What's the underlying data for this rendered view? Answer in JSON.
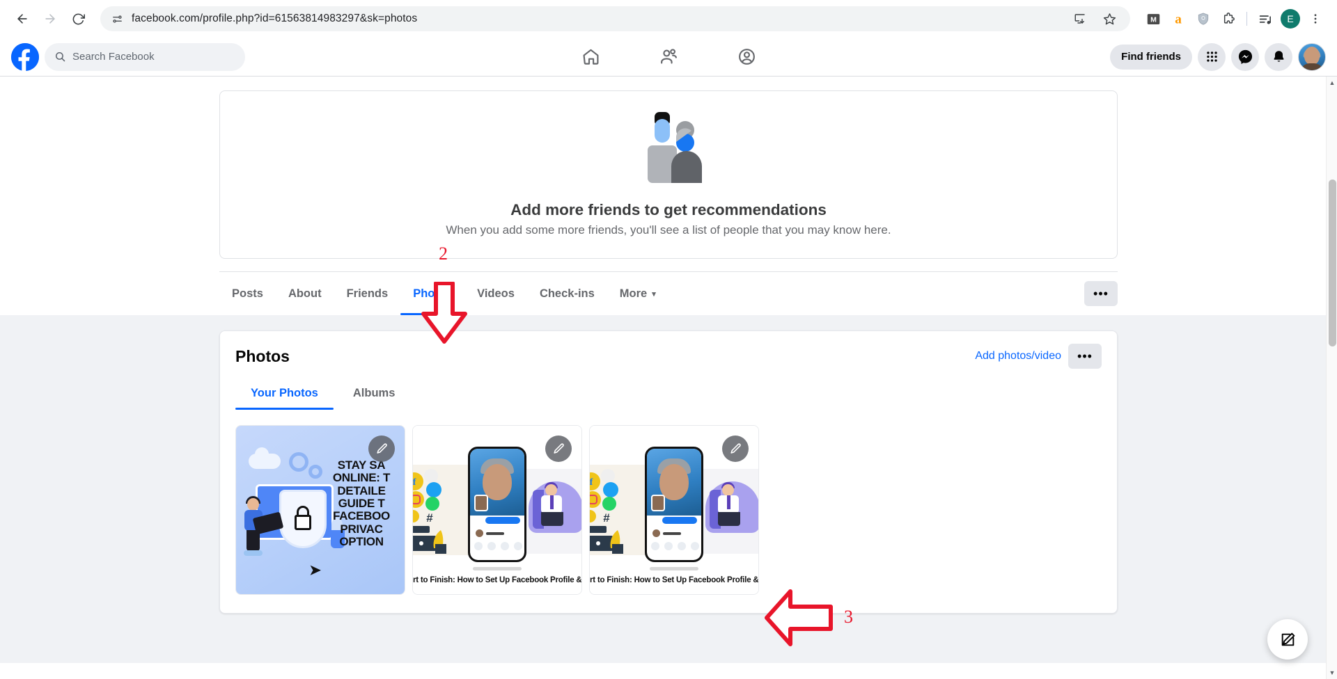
{
  "browser": {
    "back_label": "Back",
    "forward_label": "Forward",
    "reload_label": "Reload",
    "site_info_label": "View site information",
    "url": "facebook.com/profile.php?id=61563814983297&sk=photos",
    "install_label": "Install app",
    "bookmark_label": "Bookmark this tab",
    "extensions": [
      {
        "name": "mailtrack-extension-icon",
        "glyph": "M",
        "color": "#4a4a4a"
      },
      {
        "name": "amazon-extension-icon",
        "glyph": "a",
        "color": "#ff9900"
      },
      {
        "name": "shield-privacy-extension-icon",
        "glyph": "shield",
        "color": "#9aa5b1"
      },
      {
        "name": "extensions-puzzle-icon",
        "glyph": "puzzle",
        "color": "#3c4043"
      },
      {
        "name": "media-playlist-icon",
        "glyph": "playlist",
        "color": "#3c4043"
      }
    ],
    "profile_initial": "E",
    "profile_color": "#0f7b6c",
    "menu_label": "Customize and control Chrome"
  },
  "fb_header": {
    "logo_label": "Facebook",
    "search_placeholder": "Search Facebook",
    "nav": [
      {
        "name": "nav-home",
        "label": "Home"
      },
      {
        "name": "nav-friends",
        "label": "Friends"
      },
      {
        "name": "nav-profile",
        "label": "Profile"
      }
    ],
    "find_friends_label": "Find friends",
    "menu_grid_label": "Menu",
    "messenger_label": "Messenger",
    "notifications_label": "Notifications",
    "account_label": "Your profile",
    "accent_color": "#0866ff"
  },
  "recommendations": {
    "title": "Add more friends to get recommendations",
    "subtitle": "When you add some more friends, you'll see a list of people that you may know here."
  },
  "profile_tabs": {
    "items": [
      {
        "label": "Posts",
        "active": false
      },
      {
        "label": "About",
        "active": false
      },
      {
        "label": "Friends",
        "active": false
      },
      {
        "label": "Photos",
        "active": true
      },
      {
        "label": "Videos",
        "active": false
      },
      {
        "label": "Check-ins",
        "active": false
      },
      {
        "label": "More",
        "active": false,
        "caret": "▾"
      }
    ],
    "more_button_label": "•••"
  },
  "photos_section": {
    "title": "Photos",
    "add_link": "Add photos/video",
    "more_button_label": "•••",
    "sub_tabs": [
      {
        "label": "Your Photos",
        "active": true
      },
      {
        "label": "Albums",
        "active": false
      }
    ],
    "items": [
      {
        "name": "photo-thumb-1",
        "alt": "Stay Safe Online Facebook privacy guide graphic",
        "caption_lines": [
          "STAY SA",
          "ONLINE: T",
          "DETAILE",
          "GUIDE T",
          "FACEBOO",
          "PRIVAC",
          "OPTION"
        ],
        "edit_label": "Edit"
      },
      {
        "name": "photo-thumb-2",
        "alt": "How to Set Up Facebook Profile graphic",
        "caption": "rt to Finish: How to Set Up Facebook Profile & Op",
        "edit_label": "Edit"
      },
      {
        "name": "photo-thumb-3",
        "alt": "How to Set Up Facebook Profile graphic",
        "caption": "rt to Finish: How to Set Up Facebook Profile & Op",
        "edit_label": "Edit"
      }
    ]
  },
  "annotations": {
    "color": "#e8152a",
    "items": [
      {
        "name": "annotation-arrow-2",
        "number": "2",
        "direction": "down",
        "target": "Photos tab"
      },
      {
        "name": "annotation-arrow-3",
        "number": "3",
        "direction": "left",
        "target": "third photo thumbnail"
      }
    ]
  },
  "compose_button": {
    "label": "Create post"
  },
  "scrollbar": {
    "up_label": "▲",
    "down_label": "▼"
  }
}
